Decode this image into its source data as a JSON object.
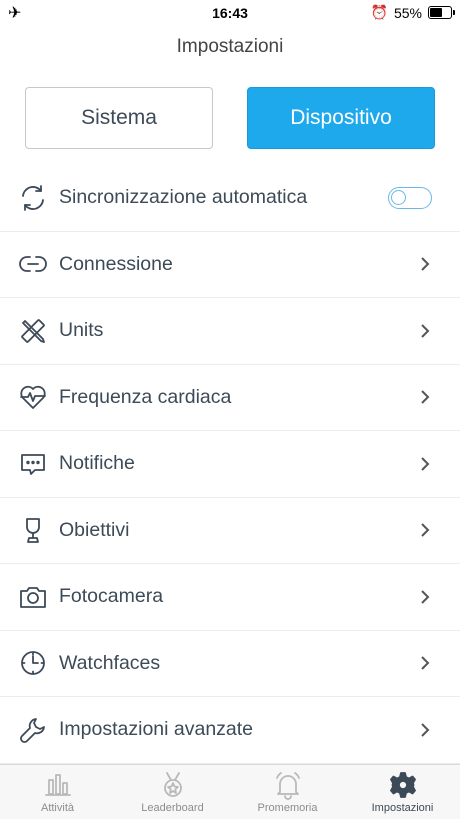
{
  "status_bar": {
    "time": "16:43",
    "battery_percent": "55%",
    "battery_level": 0.55
  },
  "header": {
    "title": "Impostazioni"
  },
  "segments": {
    "sistema": "Sistema",
    "dispositivo": "Dispositivo",
    "selected": "Dispositivo"
  },
  "settings": {
    "auto_sync": {
      "label": "Sincronizzazione automatica",
      "enabled": false
    },
    "items": [
      {
        "label": "Connessione",
        "icon": "connection-icon"
      },
      {
        "label": "Units",
        "icon": "ruler-pencil-icon"
      },
      {
        "label": "Frequenza cardiaca",
        "icon": "heart-rate-icon"
      },
      {
        "label": "Notifiche",
        "icon": "message-icon"
      },
      {
        "label": "Obiettivi",
        "icon": "trophy-icon"
      },
      {
        "label": "Fotocamera",
        "icon": "camera-icon"
      },
      {
        "label": "Watchfaces",
        "icon": "clock-icon"
      },
      {
        "label": "Impostazioni avanzate",
        "icon": "wrench-icon"
      }
    ]
  },
  "tabbar": {
    "tabs": [
      {
        "label": "Attività",
        "icon": "bar-chart-icon"
      },
      {
        "label": "Leaderboard",
        "icon": "medal-icon"
      },
      {
        "label": "Promemoria",
        "icon": "bell-icon"
      },
      {
        "label": "Impostazioni",
        "icon": "gear-icon"
      }
    ],
    "active": "Impostazioni"
  },
  "colors": {
    "accent": "#1ea9ec",
    "text": "#3d4a57",
    "toggle_border": "#6bb8e6"
  }
}
